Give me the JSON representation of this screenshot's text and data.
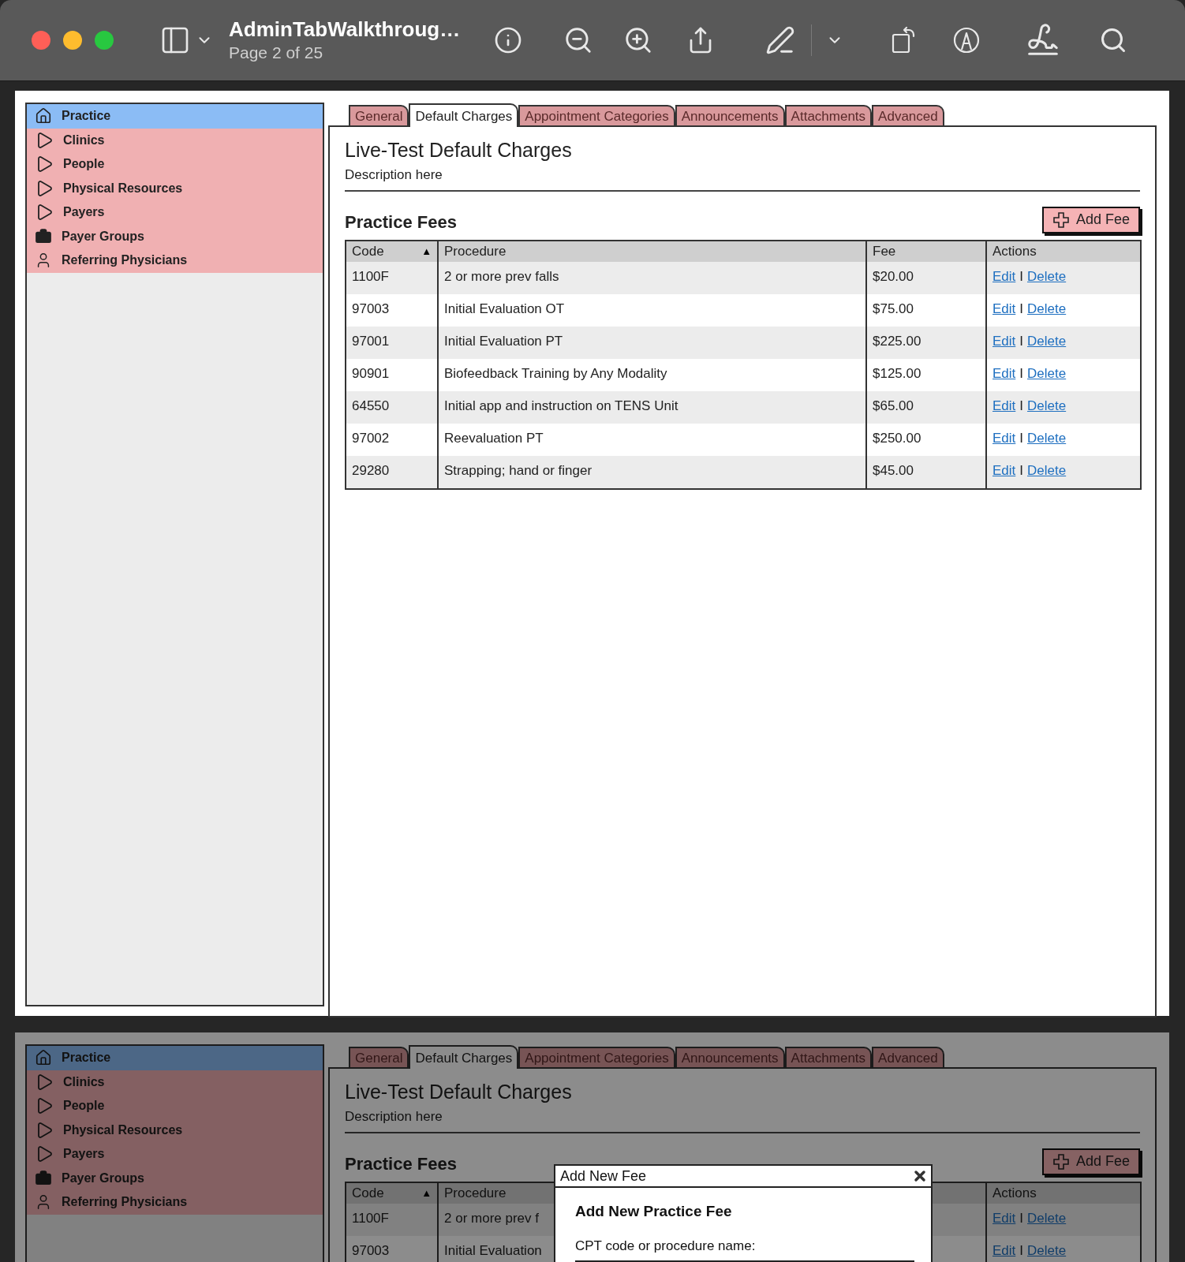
{
  "window": {
    "title": "AdminTabWalkthroug…",
    "subtitle": "Page 2 of 25"
  },
  "pages": [
    {
      "sidebar": {
        "items": [
          {
            "label": "Practice",
            "kind": "home",
            "selected": true
          },
          {
            "label": "Clinics",
            "kind": "branch",
            "selected": false
          },
          {
            "label": "People",
            "kind": "branch",
            "selected": false
          },
          {
            "label": "Physical Resources",
            "kind": "branch",
            "selected": false
          },
          {
            "label": "Payers",
            "kind": "branch",
            "selected": false
          },
          {
            "label": "Payer Groups",
            "kind": "group",
            "selected": false
          },
          {
            "label": "Referring Physicians",
            "kind": "person",
            "selected": false
          }
        ]
      },
      "tabs": [
        {
          "label": "General",
          "selected": false
        },
        {
          "label": "Default Charges",
          "selected": true
        },
        {
          "label": "Appointment Categories",
          "selected": false
        },
        {
          "label": "Announcements",
          "selected": false
        },
        {
          "label": "Attachments",
          "selected": false
        },
        {
          "label": "Advanced",
          "selected": false
        }
      ],
      "heading": "Live-Test Default Charges",
      "description": "Description here",
      "section_title": "Practice Fees",
      "add_button": "Add Fee",
      "table": {
        "columns": {
          "code": {
            "label": "Code",
            "sort": "▲"
          },
          "procedure": {
            "label": "Procedure"
          },
          "fee": {
            "label": "Fee"
          },
          "actions": {
            "label": "Actions"
          }
        },
        "rows": [
          {
            "code": "1100F",
            "procedure": "2 or more prev falls",
            "fee": "$20.00",
            "edit": "Edit",
            "separator": "I",
            "delete": "Delete"
          },
          {
            "code": "97003",
            "procedure": "Initial Evaluation OT",
            "fee": "$75.00",
            "edit": "Edit",
            "separator": "I",
            "delete": "Delete"
          },
          {
            "code": "97001",
            "procedure": "Initial Evaluation PT",
            "fee": "$225.00",
            "edit": "Edit",
            "separator": "I",
            "delete": "Delete"
          },
          {
            "code": "90901",
            "procedure": "Biofeedback Training by Any Modality",
            "fee": "$125.00",
            "edit": "Edit",
            "separator": "I",
            "delete": "Delete"
          },
          {
            "code": "64550",
            "procedure": "Initial app and instruction on TENS Unit",
            "fee": "$65.00",
            "edit": "Edit",
            "separator": "I",
            "delete": "Delete"
          },
          {
            "code": "97002",
            "procedure": "Reevaluation PT",
            "fee": "$250.00",
            "edit": "Edit",
            "separator": "I",
            "delete": "Delete"
          },
          {
            "code": "29280",
            "procedure": "Strapping; hand or finger",
            "fee": "$45.00",
            "edit": "Edit",
            "separator": "I",
            "delete": "Delete"
          }
        ]
      }
    },
    {
      "sidebar": {
        "items": [
          {
            "label": "Practice",
            "kind": "home",
            "selected": true
          },
          {
            "label": "Clinics",
            "kind": "branch",
            "selected": false
          },
          {
            "label": "People",
            "kind": "branch",
            "selected": false
          },
          {
            "label": "Physical Resources",
            "kind": "branch",
            "selected": false
          },
          {
            "label": "Payers",
            "kind": "branch",
            "selected": false
          },
          {
            "label": "Payer Groups",
            "kind": "group",
            "selected": false
          },
          {
            "label": "Referring Physicians",
            "kind": "person",
            "selected": false
          }
        ]
      },
      "tabs": [
        {
          "label": "General",
          "selected": false
        },
        {
          "label": "Default Charges",
          "selected": true
        },
        {
          "label": "Appointment Categories",
          "selected": false
        },
        {
          "label": "Announcements",
          "selected": false
        },
        {
          "label": "Attachments",
          "selected": false
        },
        {
          "label": "Advanced",
          "selected": false
        }
      ],
      "heading": "Live-Test Default Charges",
      "description": "Description here",
      "section_title": "Practice Fees",
      "add_button": "Add Fee",
      "table": {
        "columns": {
          "code": {
            "label": "Code",
            "sort": "▲"
          },
          "procedure": {
            "label": "Procedure"
          },
          "actions": {
            "label": "Actions"
          }
        },
        "rows": [
          {
            "code": "1100F",
            "procedure": "2 or more prev f",
            "edit": "Edit",
            "separator": "I",
            "delete": "Delete"
          },
          {
            "code": "97003",
            "procedure": "Initial Evaluation",
            "edit": "Edit",
            "separator": "I",
            "delete": "Delete"
          }
        ]
      },
      "dialog": {
        "title": "Add New Fee",
        "heading": "Add New Practice Fee",
        "field_label": "CPT code or procedure name:"
      }
    }
  ]
}
